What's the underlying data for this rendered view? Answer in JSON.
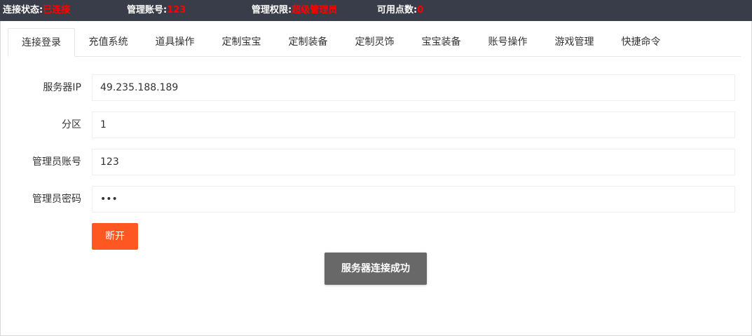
{
  "status_bar": {
    "connection_label": "连接状态:",
    "connection_value": "已连接",
    "account_label": "管理账号:",
    "account_value": "123",
    "permission_label": "管理权限:",
    "permission_value": "超级管理员",
    "points_label": "可用点数:",
    "points_value": "0",
    "colors": {
      "background": "#393d49",
      "value": "#ff0000"
    }
  },
  "tabs": [
    {
      "label": "连接登录",
      "active": true
    },
    {
      "label": "充值系统",
      "active": false
    },
    {
      "label": "道具操作",
      "active": false
    },
    {
      "label": "定制宝宝",
      "active": false
    },
    {
      "label": "定制装备",
      "active": false
    },
    {
      "label": "定制灵饰",
      "active": false
    },
    {
      "label": "宝宝装备",
      "active": false
    },
    {
      "label": "账号操作",
      "active": false
    },
    {
      "label": "游戏管理",
      "active": false
    },
    {
      "label": "快捷命令",
      "active": false
    }
  ],
  "form": {
    "server_ip": {
      "label": "服务器IP",
      "value": "49.235.188.189"
    },
    "zone": {
      "label": "分区",
      "value": "1"
    },
    "admin_account": {
      "label": "管理员账号",
      "value": "123"
    },
    "admin_password": {
      "label": "管理员密码",
      "value": "123"
    }
  },
  "disconnect_button": {
    "label": "断开",
    "color": "#ff5722"
  },
  "toast": {
    "message": "服务器连接成功"
  }
}
